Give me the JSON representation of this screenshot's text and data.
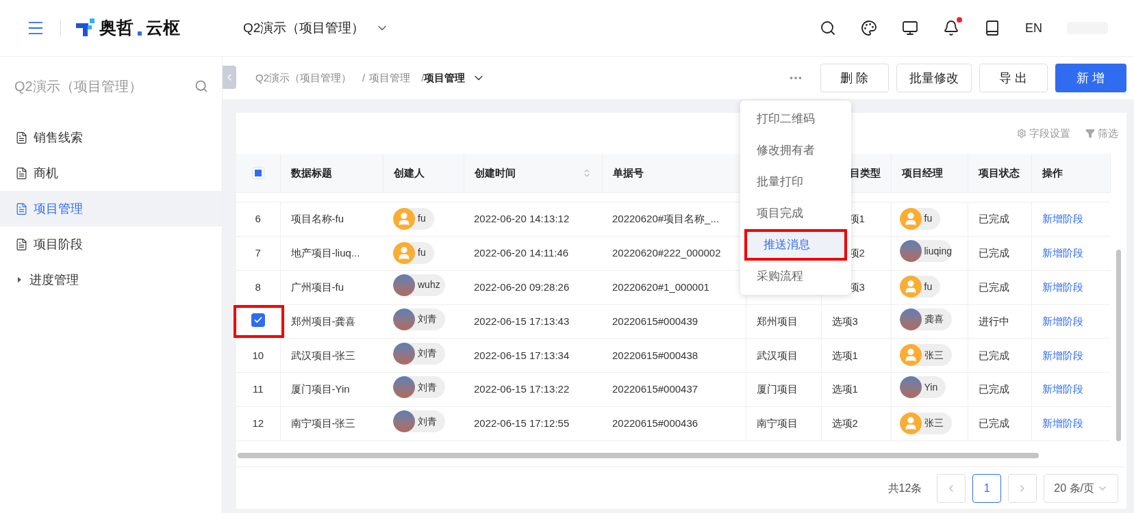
{
  "header": {
    "logo_left": "奥哲",
    "logo_right": "云枢",
    "app_selector": "Q2演示（项目管理）",
    "language": "EN",
    "has_notification": true
  },
  "sidebar": {
    "title": "Q2演示（项目管理）",
    "items": [
      {
        "label": "销售线索",
        "kind": "page",
        "selected": false
      },
      {
        "label": "商机",
        "kind": "page",
        "selected": false
      },
      {
        "label": "项目管理",
        "kind": "page",
        "selected": true
      },
      {
        "label": "项目阶段",
        "kind": "page",
        "selected": false
      },
      {
        "label": "进度管理",
        "kind": "group",
        "expanded": false
      }
    ]
  },
  "breadcrumb": {
    "items": [
      "Q2演示（项目管理）",
      "项目管理",
      "项目管理"
    ],
    "separator": "/"
  },
  "actions": [
    {
      "label": "删 除",
      "kind": "default"
    },
    {
      "label": "批量修改",
      "kind": "default"
    },
    {
      "label": "导 出",
      "kind": "default"
    },
    {
      "label": "新 增",
      "kind": "primary"
    }
  ],
  "more_menu": {
    "items": [
      {
        "label": "打印二维码",
        "selected": false,
        "annotated": false
      },
      {
        "label": "修改拥有者",
        "selected": false,
        "annotated": false
      },
      {
        "label": "批量打印",
        "selected": false,
        "annotated": false
      },
      {
        "label": "项目完成",
        "selected": false,
        "annotated": false
      },
      {
        "label": "推送消息",
        "selected": true,
        "annotated": true
      },
      {
        "label": "采购流程",
        "selected": false,
        "annotated": false
      }
    ]
  },
  "table_tools": [
    {
      "label": "字段设置",
      "kind": "settings"
    },
    {
      "label": "筛选",
      "kind": "filter"
    }
  ],
  "table": {
    "select_all": {
      "indeterminate": true
    },
    "columns": [
      {
        "label": "数据标题"
      },
      {
        "label": "创建人"
      },
      {
        "label": "创建时间",
        "sortable": true
      },
      {
        "label": "单据号"
      },
      {},
      {
        "label": "目类型"
      },
      {
        "label": "项目经理"
      },
      {
        "label": "项目状态"
      },
      {
        "label": "操作"
      }
    ],
    "rows": [
      {
        "index": "6",
        "checked": false,
        "annotated": false,
        "title": "项目名称-fu",
        "creator": {
          "name": "fu",
          "kind": "default"
        },
        "time": "2022-06-20 14:13:12",
        "number": "20220620#项目名称_...",
        "column_7": "项1",
        "manager": {
          "name": "fu",
          "kind": "default"
        },
        "status": "已完成",
        "action": "新增阶段"
      },
      {
        "index": "7",
        "checked": false,
        "annotated": false,
        "title": "地产项目-liuq...",
        "creator": {
          "name": "fu",
          "kind": "default"
        },
        "time": "2022-06-20 14:11:46",
        "number": "20220620#222_000002",
        "column_7": "项2",
        "manager": {
          "name": "liuqing",
          "kind": "photo"
        },
        "status": "已完成",
        "action": "新增阶段"
      },
      {
        "index": "8",
        "checked": false,
        "annotated": false,
        "title": "广州项目-fu",
        "creator": {
          "name": "wuhz",
          "kind": "photo"
        },
        "time": "2022-06-20 09:28:26",
        "number": "20220620#1_000001",
        "column_7": "项3",
        "manager": {
          "name": "fu",
          "kind": "default"
        },
        "status": "已完成",
        "action": "新增阶段"
      },
      {
        "checked": true,
        "annotated": true,
        "title": "郑州项目-龚喜",
        "creator": {
          "name": "刘青",
          "kind": "photo"
        },
        "time": "2022-06-15 17:13:43",
        "number": "20220615#000439",
        "column_6": "郑州项目",
        "column_7": "选项3",
        "manager": {
          "name": "龚喜",
          "kind": "photo"
        },
        "status": "进行中",
        "action": "新增阶段"
      },
      {
        "index": "10",
        "checked": false,
        "annotated": false,
        "title": "武汉项目-张三",
        "creator": {
          "name": "刘青",
          "kind": "photo"
        },
        "time": "2022-06-15 17:13:34",
        "number": "20220615#000438",
        "column_6": "武汉项目",
        "column_7": "选项1",
        "manager": {
          "name": "张三",
          "kind": "default"
        },
        "status": "已完成",
        "action": "新增阶段"
      },
      {
        "index": "11",
        "checked": false,
        "annotated": false,
        "title": "厦门项目-Yin",
        "creator": {
          "name": "刘青",
          "kind": "photo"
        },
        "time": "2022-06-15 17:13:22",
        "number": "20220615#000437",
        "column_6": "厦门项目",
        "column_7": "选项1",
        "manager": {
          "name": "Yin",
          "kind": "photo"
        },
        "status": "已完成",
        "action": "新增阶段"
      },
      {
        "index": "12",
        "checked": false,
        "annotated": false,
        "title": "南宁项目-张三",
        "creator": {
          "name": "刘青",
          "kind": "photo"
        },
        "time": "2022-06-15 17:12:55",
        "number": "20220615#000436",
        "column_6": "南宁项目",
        "column_7": "选项2",
        "manager": {
          "name": "张三",
          "kind": "default"
        },
        "status": "已完成",
        "action": "新增阶段"
      }
    ]
  },
  "pagination": {
    "total": "共12条",
    "pages": [
      {
        "label": "1",
        "selected": true
      }
    ],
    "page_size": "20 条/页"
  }
}
